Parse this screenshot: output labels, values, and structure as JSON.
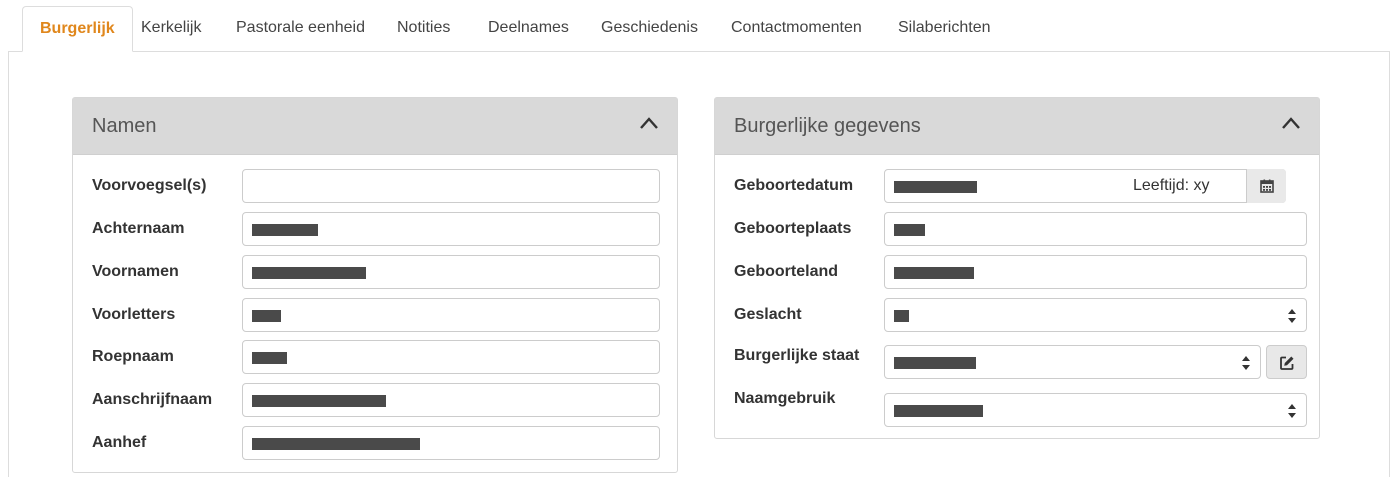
{
  "tabs": [
    {
      "label": "Burgerlijk",
      "active": true
    },
    {
      "label": "Kerkelijk"
    },
    {
      "label": "Pastorale eenheid"
    },
    {
      "label": "Notities"
    },
    {
      "label": "Deelnames"
    },
    {
      "label": "Geschiedenis"
    },
    {
      "label": "Contactmomenten"
    },
    {
      "label": "Silaberichten"
    }
  ],
  "colors": {
    "accent": "#e0871c",
    "panel_header": "#d9d9d9",
    "redaction": "#4a4a4a"
  },
  "namen": {
    "title": "Namen",
    "fields": [
      {
        "label": "Voorvoegsel(s)",
        "value": ""
      },
      {
        "label": "Achternaam",
        "value": "[redacted]"
      },
      {
        "label": "Voornamen",
        "value": "[redacted]"
      },
      {
        "label": "Voorletters",
        "value": "[redacted]"
      },
      {
        "label": "Roepnaam",
        "value": "[redacted]"
      },
      {
        "label": "Aanschrijfnaam",
        "value": "[redacted]"
      },
      {
        "label": "Aanhef",
        "value": "[redacted]"
      }
    ]
  },
  "burgerlijk": {
    "title": "Burgerlijke gegevens",
    "geboortedatum": {
      "label": "Geboortedatum",
      "value": "[redacted]",
      "age_text": "Leeftijd: xy"
    },
    "geboorteplaats": {
      "label": "Geboorteplaats",
      "value": "[redacted]"
    },
    "geboorteland": {
      "label": "Geboorteland",
      "value": "[redacted]"
    },
    "geslacht": {
      "label": "Geslacht",
      "value": "[redacted]"
    },
    "staat": {
      "label": "Burgerlijke staat",
      "value": "[redacted]"
    },
    "naamgebruik": {
      "label": "Naamgebruik",
      "value": "[redacted]"
    }
  },
  "icons": [
    "chevron-up-icon",
    "calendar-icon",
    "edit-icon",
    "select-arrows-icon"
  ]
}
